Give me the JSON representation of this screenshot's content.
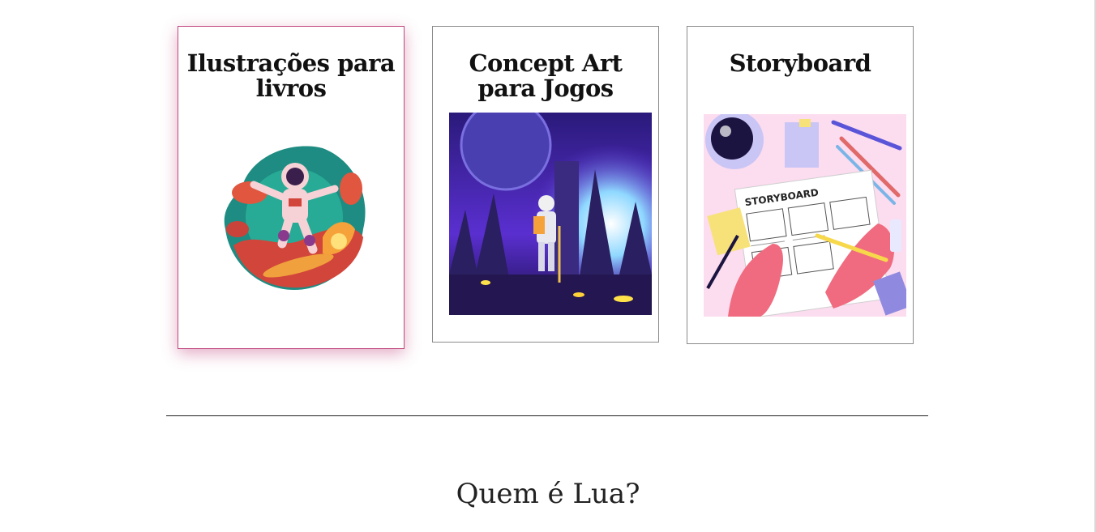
{
  "cards": [
    {
      "title": "Ilustrações para livros",
      "image": "astronaut-skateboard-illustration",
      "active": true
    },
    {
      "title": "Concept Art para Jogos",
      "image": "space-knight-concept-art"
    },
    {
      "title": "Storyboard",
      "image": "storyboard-drawing-illustration",
      "image_label": "STORYBOARD"
    }
  ],
  "section": {
    "title": "Quem é Lua?"
  },
  "colors": {
    "active_border": "#c0497f",
    "border": "#8a8a8a"
  }
}
